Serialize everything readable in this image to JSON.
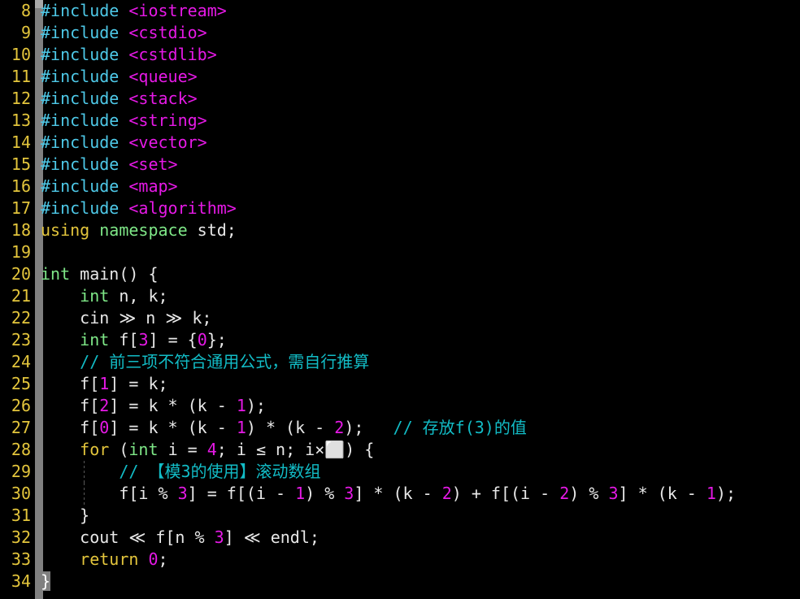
{
  "editor": {
    "background": "#000000",
    "default_text_color": "#e8e8e8",
    "line_number_color": "#e3c53c",
    "gutter_change_bar_color": "#808080",
    "first_visible_line": 8,
    "last_visible_line": 34,
    "language": "C++",
    "colors": {
      "preprocessor": "#4ec9e8",
      "header_name": "#e619e6",
      "keyword": "#e3c53c",
      "type": "#7ee787",
      "number": "#e619e6",
      "comment": "#12bcc6",
      "identifier": "#e8e8e8",
      "indent_guide": "#585858"
    }
  },
  "lines": [
    {
      "number": "8",
      "indent": 0,
      "tokens": [
        {
          "text": "#include ",
          "cls": "t-pre"
        },
        {
          "text": "<iostream>",
          "cls": "t-header"
        }
      ]
    },
    {
      "number": "9",
      "indent": 0,
      "tokens": [
        {
          "text": "#include ",
          "cls": "t-pre"
        },
        {
          "text": "<cstdio>",
          "cls": "t-header"
        }
      ]
    },
    {
      "number": "10",
      "indent": 0,
      "tokens": [
        {
          "text": "#include ",
          "cls": "t-pre"
        },
        {
          "text": "<cstdlib>",
          "cls": "t-header"
        }
      ]
    },
    {
      "number": "11",
      "indent": 0,
      "tokens": [
        {
          "text": "#include ",
          "cls": "t-pre"
        },
        {
          "text": "<queue>",
          "cls": "t-header"
        }
      ]
    },
    {
      "number": "12",
      "indent": 0,
      "tokens": [
        {
          "text": "#include ",
          "cls": "t-pre"
        },
        {
          "text": "<stack>",
          "cls": "t-header"
        }
      ]
    },
    {
      "number": "13",
      "indent": 0,
      "tokens": [
        {
          "text": "#include ",
          "cls": "t-pre"
        },
        {
          "text": "<string>",
          "cls": "t-header"
        }
      ]
    },
    {
      "number": "14",
      "indent": 0,
      "tokens": [
        {
          "text": "#include ",
          "cls": "t-pre"
        },
        {
          "text": "<vector>",
          "cls": "t-header"
        }
      ]
    },
    {
      "number": "15",
      "indent": 0,
      "tokens": [
        {
          "text": "#include ",
          "cls": "t-pre"
        },
        {
          "text": "<set>",
          "cls": "t-header"
        }
      ]
    },
    {
      "number": "16",
      "indent": 0,
      "tokens": [
        {
          "text": "#include ",
          "cls": "t-pre"
        },
        {
          "text": "<map>",
          "cls": "t-header"
        }
      ]
    },
    {
      "number": "17",
      "indent": 0,
      "tokens": [
        {
          "text": "#include ",
          "cls": "t-pre"
        },
        {
          "text": "<algorithm>",
          "cls": "t-header"
        }
      ]
    },
    {
      "number": "18",
      "indent": 0,
      "tokens": [
        {
          "text": "using ",
          "cls": "t-kw"
        },
        {
          "text": "namespace ",
          "cls": "t-type"
        },
        {
          "text": "std;",
          "cls": "t-id"
        }
      ]
    },
    {
      "number": "19",
      "indent": 0,
      "tokens": []
    },
    {
      "number": "20",
      "indent": 0,
      "tokens": [
        {
          "text": "int ",
          "cls": "t-type"
        },
        {
          "text": "main() {",
          "cls": "t-id"
        }
      ]
    },
    {
      "number": "21",
      "indent": 0,
      "tokens": [
        {
          "text": "    ",
          "cls": "t-id"
        },
        {
          "text": "int ",
          "cls": "t-type"
        },
        {
          "text": "n, k;",
          "cls": "t-id"
        }
      ]
    },
    {
      "number": "22",
      "indent": 0,
      "tokens": [
        {
          "text": "    cin ≫ n ≫ k;",
          "cls": "t-id"
        }
      ]
    },
    {
      "number": "23",
      "indent": 0,
      "tokens": [
        {
          "text": "    ",
          "cls": "t-id"
        },
        {
          "text": "int ",
          "cls": "t-type"
        },
        {
          "text": "f[",
          "cls": "t-id"
        },
        {
          "text": "3",
          "cls": "t-num"
        },
        {
          "text": "] = {",
          "cls": "t-id"
        },
        {
          "text": "0",
          "cls": "t-num"
        },
        {
          "text": "};",
          "cls": "t-id"
        }
      ]
    },
    {
      "number": "24",
      "indent": 0,
      "tokens": [
        {
          "text": "    ",
          "cls": "t-id"
        },
        {
          "text": "// 前三项不符合通用公式，需自行推算",
          "cls": "t-cmt"
        }
      ]
    },
    {
      "number": "25",
      "indent": 0,
      "tokens": [
        {
          "text": "    f[",
          "cls": "t-id"
        },
        {
          "text": "1",
          "cls": "t-num"
        },
        {
          "text": "] = k;",
          "cls": "t-id"
        }
      ]
    },
    {
      "number": "26",
      "indent": 0,
      "tokens": [
        {
          "text": "    f[",
          "cls": "t-id"
        },
        {
          "text": "2",
          "cls": "t-num"
        },
        {
          "text": "] = k * (k - ",
          "cls": "t-id"
        },
        {
          "text": "1",
          "cls": "t-num"
        },
        {
          "text": ");",
          "cls": "t-id"
        }
      ]
    },
    {
      "number": "27",
      "indent": 0,
      "tokens": [
        {
          "text": "    f[",
          "cls": "t-id"
        },
        {
          "text": "0",
          "cls": "t-num"
        },
        {
          "text": "] = k * (k - ",
          "cls": "t-id"
        },
        {
          "text": "1",
          "cls": "t-num"
        },
        {
          "text": ") * (k - ",
          "cls": "t-id"
        },
        {
          "text": "2",
          "cls": "t-num"
        },
        {
          "text": ");   ",
          "cls": "t-id"
        },
        {
          "text": "// 存放f(3)的值",
          "cls": "t-cmt"
        }
      ]
    },
    {
      "number": "28",
      "indent": 0,
      "tokens": [
        {
          "text": "    ",
          "cls": "t-id"
        },
        {
          "text": "for ",
          "cls": "t-kw"
        },
        {
          "text": "(",
          "cls": "t-id"
        },
        {
          "text": "int ",
          "cls": "t-type"
        },
        {
          "text": "i = ",
          "cls": "t-id"
        },
        {
          "text": "4",
          "cls": "t-num"
        },
        {
          "text": "; i ≤ n; i⨯⬜) {",
          "cls": "t-id"
        }
      ]
    },
    {
      "number": "29",
      "indent": 1,
      "tokens": [
        {
          "text": "        ",
          "cls": "t-id"
        },
        {
          "text": "// 【模3的使用】滚动数组",
          "cls": "t-cmt"
        }
      ]
    },
    {
      "number": "30",
      "indent": 1,
      "tokens": [
        {
          "text": "        f[i % ",
          "cls": "t-id"
        },
        {
          "text": "3",
          "cls": "t-num"
        },
        {
          "text": "] = f[(i - ",
          "cls": "t-id"
        },
        {
          "text": "1",
          "cls": "t-num"
        },
        {
          "text": ") % ",
          "cls": "t-id"
        },
        {
          "text": "3",
          "cls": "t-num"
        },
        {
          "text": "] * (k - ",
          "cls": "t-id"
        },
        {
          "text": "2",
          "cls": "t-num"
        },
        {
          "text": ") + f[(i - ",
          "cls": "t-id"
        },
        {
          "text": "2",
          "cls": "t-num"
        },
        {
          "text": ") % ",
          "cls": "t-id"
        },
        {
          "text": "3",
          "cls": "t-num"
        },
        {
          "text": "] * (k - ",
          "cls": "t-id"
        },
        {
          "text": "1",
          "cls": "t-num"
        },
        {
          "text": ");",
          "cls": "t-id"
        }
      ]
    },
    {
      "number": "31",
      "indent": 0,
      "tokens": [
        {
          "text": "    }",
          "cls": "t-id"
        }
      ]
    },
    {
      "number": "32",
      "indent": 0,
      "tokens": [
        {
          "text": "    cout ≪ f[n % ",
          "cls": "t-id"
        },
        {
          "text": "3",
          "cls": "t-num"
        },
        {
          "text": "] ≪ endl;",
          "cls": "t-id"
        }
      ]
    },
    {
      "number": "33",
      "indent": 0,
      "tokens": [
        {
          "text": "    ",
          "cls": "t-id"
        },
        {
          "text": "return ",
          "cls": "t-kw"
        },
        {
          "text": "0",
          "cls": "t-num"
        },
        {
          "text": ";",
          "cls": "t-id"
        }
      ]
    },
    {
      "number": "34",
      "indent": 0,
      "brace_highlight": true,
      "tokens": [
        {
          "text": "}",
          "cls": "t-id"
        }
      ]
    }
  ]
}
